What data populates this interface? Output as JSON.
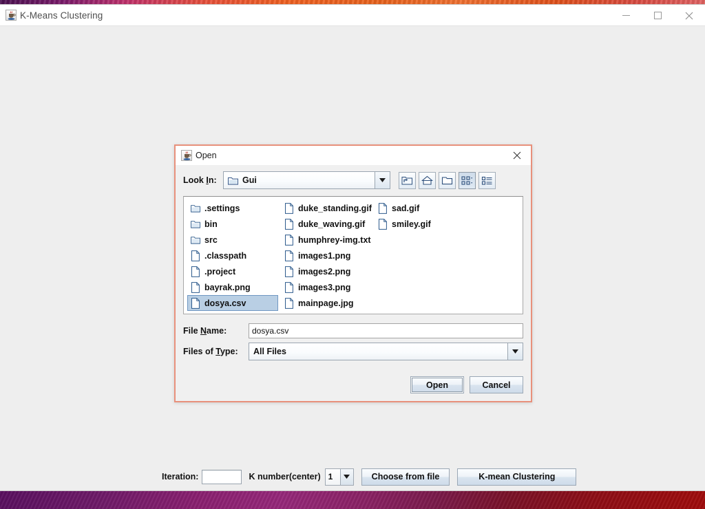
{
  "window": {
    "title": "K-Means Clustering",
    "icon": "java-coffee-cup-icon",
    "controls": {
      "minimize": "minimize-icon",
      "maximize": "maximize-icon",
      "close": "close-icon"
    }
  },
  "bottom_bar": {
    "iteration_label": "Iteration:",
    "iteration_value": "",
    "k_number_label": "K number(center)",
    "k_number_value": "1",
    "choose_file_label": "Choose from file",
    "kmean_label": "K-mean Clustering"
  },
  "dialog": {
    "title": "Open",
    "icon": "java-coffee-cup-icon",
    "close_icon": "close-icon",
    "look_in": {
      "label_pre": "Look ",
      "label_accel": "I",
      "label_post": "n:",
      "value": "Gui",
      "icon": "folder-icon",
      "arrow_icon": "chevron-down-icon"
    },
    "toolbar": [
      {
        "name": "up-one-level-button",
        "icon": "folder-up-arrow-icon"
      },
      {
        "name": "home-button",
        "icon": "home-icon"
      },
      {
        "name": "new-folder-button",
        "icon": "new-folder-icon"
      },
      {
        "name": "list-view-button",
        "icon": "grid-view-icon",
        "pressed": true
      },
      {
        "name": "details-view-button",
        "icon": "details-list-icon",
        "pressed": false
      }
    ],
    "files": [
      {
        "name": ".settings",
        "type": "folder",
        "selected": false
      },
      {
        "name": "bin",
        "type": "folder",
        "selected": false
      },
      {
        "name": "src",
        "type": "folder",
        "selected": false
      },
      {
        "name": ".classpath",
        "type": "file",
        "selected": false
      },
      {
        "name": ".project",
        "type": "file",
        "selected": false
      },
      {
        "name": "bayrak.png",
        "type": "file",
        "selected": false
      },
      {
        "name": "dosya.csv",
        "type": "file",
        "selected": true
      },
      {
        "name": "duke_standing.gif",
        "type": "file",
        "selected": false
      },
      {
        "name": "duke_waving.gif",
        "type": "file",
        "selected": false
      },
      {
        "name": "humphrey-img.txt",
        "type": "file",
        "selected": false
      },
      {
        "name": "images1.png",
        "type": "file",
        "selected": false
      },
      {
        "name": "images2.png",
        "type": "file",
        "selected": false
      },
      {
        "name": "images3.png",
        "type": "file",
        "selected": false
      },
      {
        "name": "mainpage.jpg",
        "type": "file",
        "selected": false
      },
      {
        "name": "sad.gif",
        "type": "file",
        "selected": false
      },
      {
        "name": "smiley.gif",
        "type": "file",
        "selected": false
      }
    ],
    "file_name": {
      "label_pre": "File ",
      "label_accel": "N",
      "label_post": "ame:",
      "value": "dosya.csv",
      "placeholder": ""
    },
    "files_of_type": {
      "label_pre": "Files of ",
      "label_accel": "T",
      "label_post": "ype:",
      "value": "All Files",
      "arrow_icon": "chevron-down-icon"
    },
    "actions": {
      "open_label": "Open",
      "cancel_label": "Cancel"
    }
  },
  "colors": {
    "dialog_border": "#e8907b",
    "selection": "#b9cfe4",
    "app_background": "#eeeeee"
  }
}
